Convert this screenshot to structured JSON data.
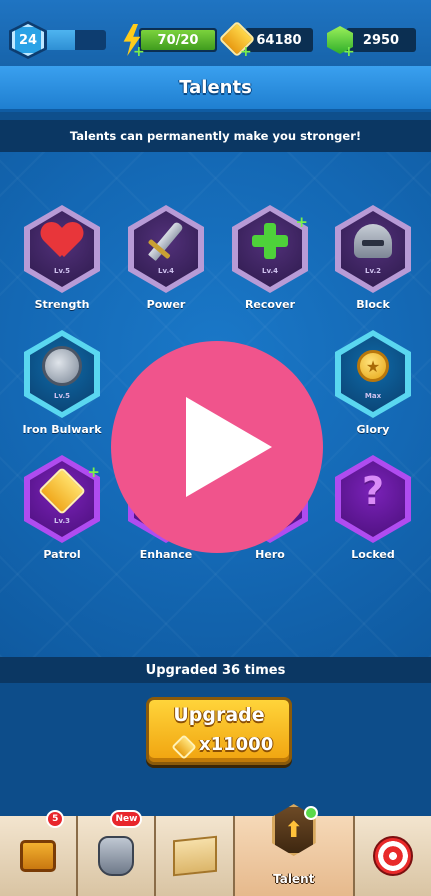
{
  "player": {
    "level": "24",
    "xp_fraction": 0.55
  },
  "resources": {
    "energy": "70/20",
    "energy_fraction": 1.0,
    "gold": "64180",
    "gems": "2950",
    "plus_symbol": "+"
  },
  "header": {
    "title": "Talents",
    "subtitle": "Talents can permanently make you stronger!"
  },
  "talents": [
    {
      "name": "Strength",
      "level": "Lv.5",
      "icon": "heart-icon",
      "frame": "purple"
    },
    {
      "name": "Power",
      "level": "Lv.4",
      "icon": "sword-icon",
      "frame": "purple"
    },
    {
      "name": "Recover",
      "level": "Lv.4",
      "icon": "green-cross-icon",
      "frame": "purple",
      "upgradable": true
    },
    {
      "name": "Block",
      "level": "Lv.2",
      "icon": "helmet-icon",
      "frame": "purple"
    },
    {
      "name": "Iron Bulwark",
      "level": "Lv.5",
      "icon": "round-shield-icon",
      "frame": "cyan"
    },
    {
      "name": "Glory",
      "level": "Max",
      "icon": "medal-icon",
      "frame": "cyan"
    },
    {
      "name": "Patrol",
      "level": "Lv.3",
      "icon": "bow-card-icon",
      "frame": "violet",
      "upgradable": true
    },
    {
      "name": "Enhance",
      "level": "",
      "icon": "up-arrow-icon",
      "frame": "violet"
    },
    {
      "name": "Hero",
      "level": "",
      "icon": "banner-icon",
      "frame": "violet"
    },
    {
      "name": "Locked",
      "level": "",
      "icon": "question-mark-icon",
      "frame": "violet",
      "question_mark": "?"
    }
  ],
  "upgrade": {
    "info": "Upgraded 36 times",
    "button_label": "Upgrade",
    "cost": "x11000",
    "cost_icon": "gold-coin-icon"
  },
  "nav": {
    "tabs": [
      {
        "id": "chest",
        "icon": "treasure-chest-icon",
        "badge": "5"
      },
      {
        "id": "equipment",
        "icon": "armor-icon",
        "badge": "New"
      },
      {
        "id": "map",
        "icon": "map-icon"
      },
      {
        "id": "talent",
        "icon": "talent-icon",
        "label": "Talent",
        "active": true
      },
      {
        "id": "archery",
        "icon": "target-icon"
      }
    ]
  },
  "overlay": {
    "icon": "play-icon",
    "color": "#f0548c"
  }
}
